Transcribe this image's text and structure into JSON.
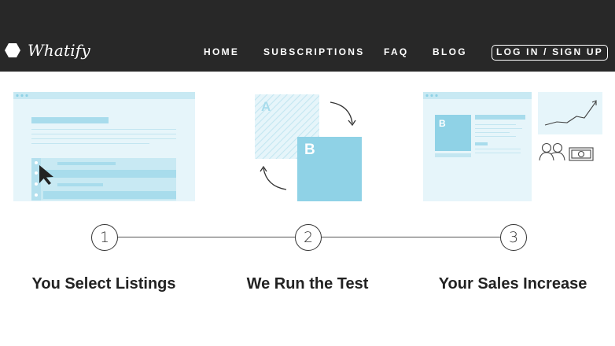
{
  "brand": {
    "name": "Whatify"
  },
  "nav": {
    "items": [
      "HOME",
      "SUBSCRIPTIONS",
      "FAQ",
      "BLOG"
    ],
    "login": "LOG IN / SIGN UP"
  },
  "illustrations": {
    "ab_test": {
      "label_a": "A",
      "label_b": "B"
    },
    "sales": {
      "card_label": "B"
    }
  },
  "steps": [
    {
      "number": "1",
      "title": "You Select Listings"
    },
    {
      "number": "2",
      "title": "We Run the Test"
    },
    {
      "number": "3",
      "title": "Your Sales Increase"
    }
  ],
  "colors": {
    "header_bg": "#282828",
    "accent_blue": "#8fd2e6",
    "light_blue": "#e6f5fa",
    "mid_blue": "#c8e9f3"
  }
}
